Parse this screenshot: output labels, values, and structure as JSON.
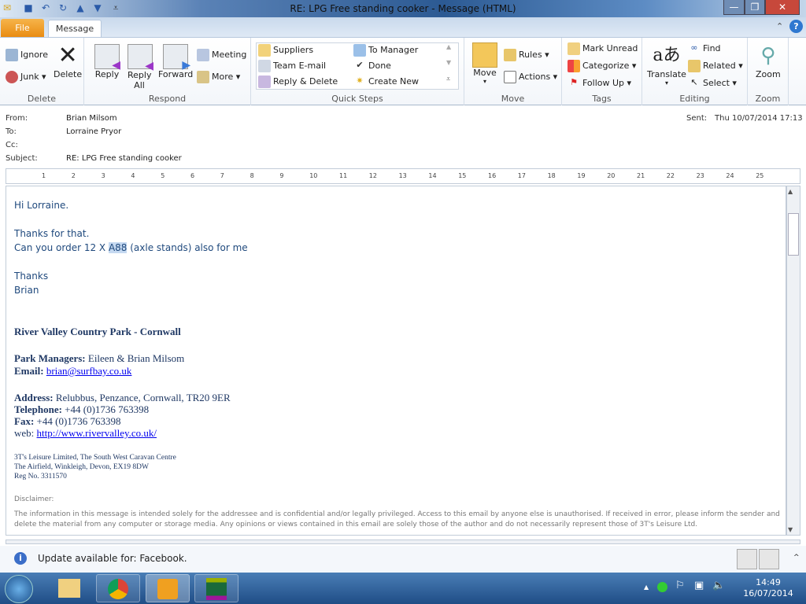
{
  "window": {
    "title": "RE: LPG Free standing cooker  -  Message (HTML)",
    "minimize": "—",
    "restore": "❐",
    "close": "✕"
  },
  "tabs": {
    "file": "File",
    "message": "Message"
  },
  "ribbon": {
    "delete": {
      "label": "Delete",
      "ignore": "Ignore",
      "junk": "Junk",
      "delete": "Delete"
    },
    "respond": {
      "label": "Respond",
      "reply": "Reply",
      "reply_all": "Reply All",
      "forward": "Forward",
      "meeting": "Meeting",
      "more": "More"
    },
    "quick_steps": {
      "label": "Quick Steps",
      "items": [
        "Suppliers",
        "To Manager",
        "Team E-mail",
        "Done",
        "Reply & Delete",
        "Create New"
      ]
    },
    "move": {
      "label": "Move",
      "move": "Move",
      "rules": "Rules",
      "actions": "Actions"
    },
    "tags": {
      "label": "Tags",
      "mark_unread": "Mark Unread",
      "categorize": "Categorize",
      "follow_up": "Follow Up"
    },
    "editing": {
      "label": "Editing",
      "translate": "Translate",
      "find": "Find",
      "related": "Related",
      "select": "Select"
    },
    "zoom": {
      "label": "Zoom",
      "zoom": "Zoom"
    }
  },
  "header": {
    "from_label": "From:",
    "from": "Brian Milsom",
    "to_label": "To:",
    "to": "Lorraine Pryor",
    "cc_label": "Cc:",
    "subject_label": "Subject:",
    "subject": "RE: LPG Free standing cooker",
    "sent_label": "Sent:",
    "sent": "Thu 10/07/2014 17:13"
  },
  "ruler": [
    "1",
    "2",
    "3",
    "4",
    "5",
    "6",
    "7",
    "8",
    "9",
    "10",
    "11",
    "12",
    "13",
    "14",
    "15",
    "16",
    "17",
    "18",
    "19",
    "20",
    "21",
    "22",
    "23",
    "24",
    "25"
  ],
  "body": {
    "greeting": "Hi Lorraine.",
    "line1": "Thanks for that.",
    "line2_pre": "Can you order 12 X ",
    "line2_sel": "A88",
    "line2_post": " (axle stands) also for me",
    "thanks": "Thanks",
    "name": "Brian"
  },
  "signature": {
    "park": "River Valley Country Park - Cornwall",
    "managers_label": "Park Managers:",
    "managers": " Eileen & Brian Milsom",
    "email_label": "Email:",
    "email": "brian@surfbay.co.uk",
    "address_label": "Address:",
    "address": " Relubbus, Penzance, Cornwall, TR20 9ER",
    "telephone_label": "Telephone:",
    "telephone": " +44 (0)1736 763398",
    "fax_label": "Fax:",
    "fax": " +44 (0)1736 763398",
    "web_label": "web: ",
    "web": "http://www.rivervalley.co.uk/",
    "company1": "3T's Leisure Limited, The South West Caravan Centre",
    "company2": "The Airfield, Winkleigh, Devon, EX19 8DW",
    "company3": "Reg No. 3311570",
    "disclaimer_label": "Disclaimer:",
    "disclaimer": "The information in this message is intended solely for the addressee and is confidential and/or legally privileged. Access to this email by anyone else is unauthorised. If received in error, please inform the sender and delete the material from any computer or storage media. Any opinions or views contained in this email are solely those of the author and do not necessarily represent those of  3T's Leisure Ltd."
  },
  "people_pane": {
    "notice": "Update available for: Facebook."
  },
  "taskbar": {
    "time": "14:49",
    "date": "16/07/2014"
  }
}
